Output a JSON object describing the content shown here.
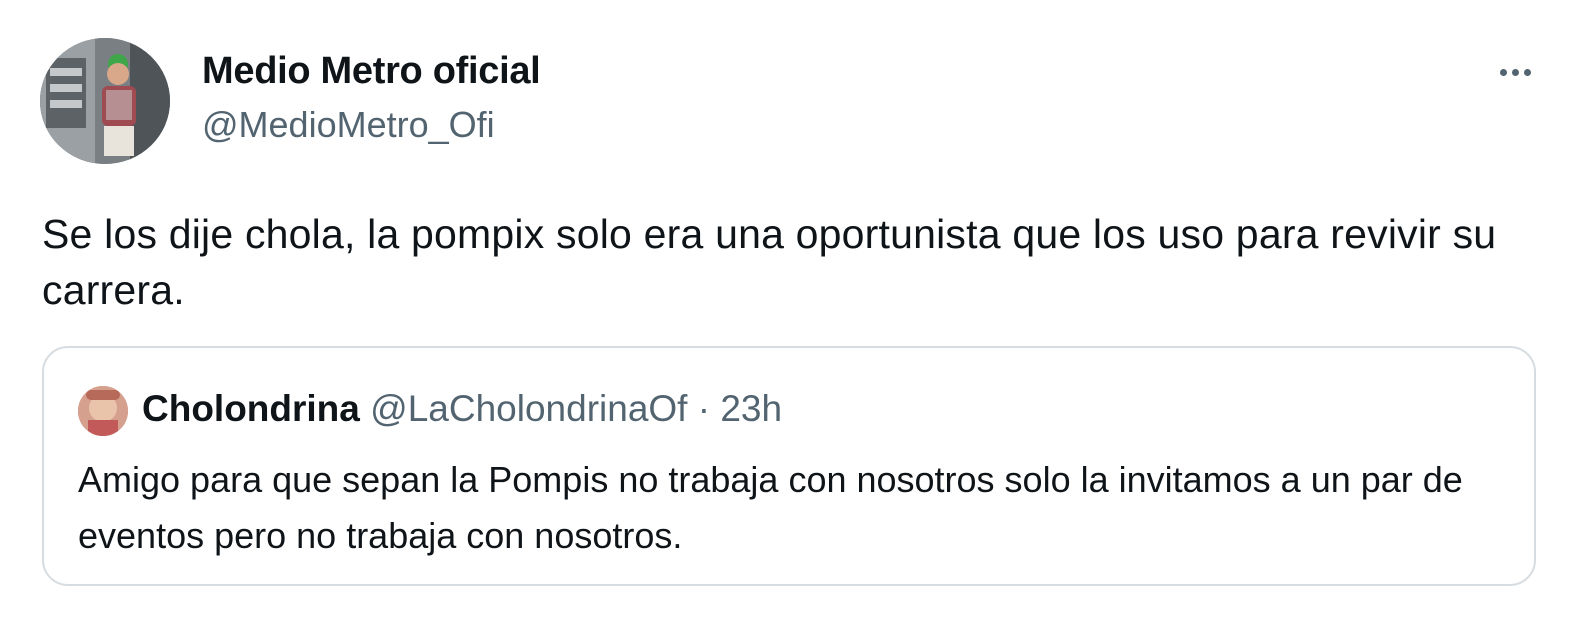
{
  "author": {
    "display_name": "Medio Metro oficial",
    "handle": "@MedioMetro_Ofi",
    "avatar_icon": "profile-photo-avatar"
  },
  "menu": {
    "icon": "more-horizontal-icon"
  },
  "tweet": {
    "text": "Se los dije chola, la pompix solo era una oportunista que los uso para revivir su carrera."
  },
  "quote": {
    "display_name": "Cholondrina",
    "handle": "@LaCholondrinaOf",
    "separator": "·",
    "time": "23h",
    "text": "Amigo para que sepan la Pompis no trabaja con nosotros solo la invitamos a un par de eventos pero no trabaja con nosotros.",
    "avatar_icon": "profile-photo-avatar"
  },
  "colors": {
    "text_primary": "#0f1419",
    "text_secondary": "#536471",
    "border": "#d7dce0"
  }
}
